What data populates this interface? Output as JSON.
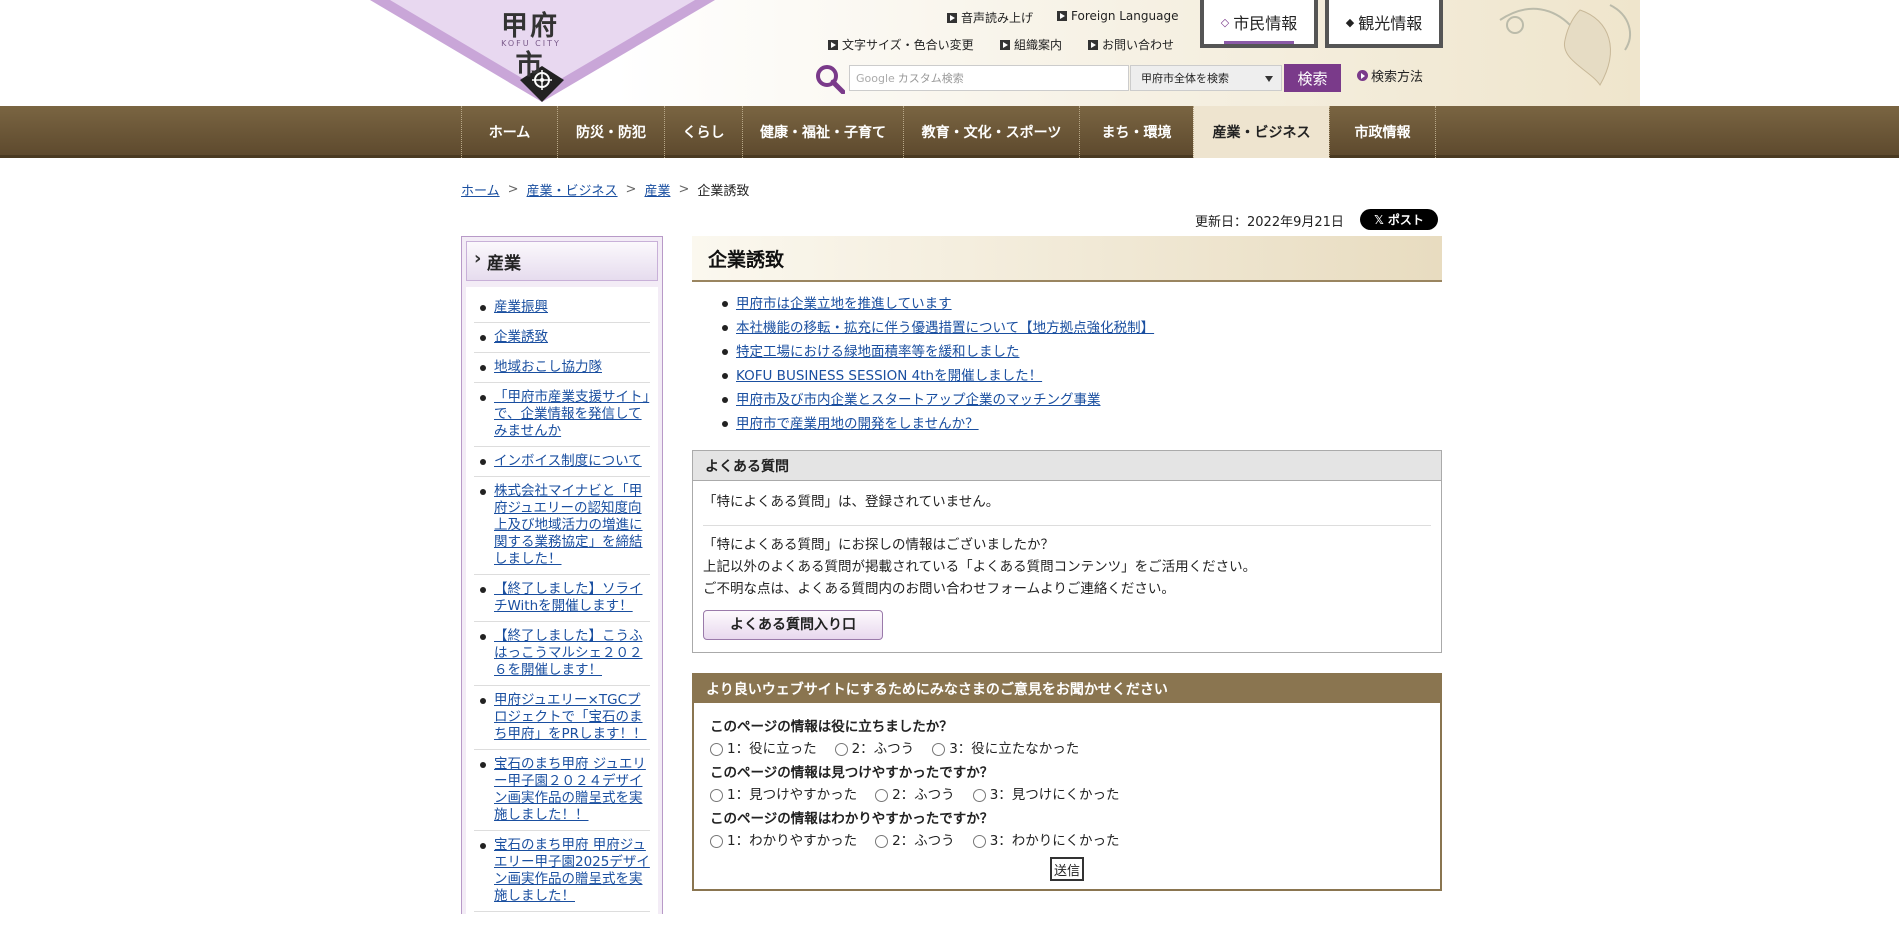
{
  "header": {
    "logo_text": "甲府市",
    "logo_sub": "KOFU CITY",
    "top_links": [
      "音声読み上げ",
      "Foreign Language",
      "文字サイズ・色合い変更",
      "組織案内",
      "お問い合わせ"
    ],
    "tab_citizen": "市民情報",
    "tab_tourism": "観光情報",
    "search_placeholder": "カスタム検索",
    "search_google": "Google",
    "search_scope": "甲府市全体を検索",
    "search_button": "検索",
    "search_help": "検索方法"
  },
  "nav": {
    "items": [
      "ホーム",
      "防災・防犯",
      "くらし",
      "健康・福祉・子育て",
      "教育・文化・スポーツ",
      "まち・環境",
      "産業・ビジネス",
      "市政情報"
    ],
    "active": "産業・ビジネス"
  },
  "breadcrumb": {
    "items": [
      "ホーム",
      "産業・ビジネス",
      "産業"
    ],
    "current": "企業誘致"
  },
  "updated": "更新日：2022年9月21日",
  "xpost_label": "ポスト",
  "side": {
    "title": "産業",
    "items": [
      "産業振興",
      "企業誘致",
      "地域おこし協力隊",
      "「甲府市産業支援サイト」で、企業情報を発信してみませんか",
      "インボイス制度について",
      "株式会社マイナビと「甲府ジュエリーの認知度向上及び地域活力の増進に関する業務協定」を締結しました！",
      "【終了しました】ソライチWithを開催します！",
      "【終了しました】こうふはっこうマルシェ２０２６を開催します！",
      "甲府ジュエリー×TGCプロジェクトで「宝石のまち甲府」をPRします！！",
      "宝石のまち甲府 ジュエリー甲子園２０２４デザイン画実作品の贈呈式を実施しました！！",
      "宝石のまち甲府 甲府ジュエリー甲子園2025デザイン画実作品の贈呈式を実施しました！"
    ]
  },
  "main": {
    "title": "企業誘致",
    "links": [
      "甲府市は企業立地を推進しています",
      "本社機能の移転・拡充に伴う優遇措置について【地方拠点強化税制】",
      "特定工場における緑地面積率等を緩和しました",
      "KOFU BUSINESS SESSION 4thを開催しました！",
      "甲府市及び市内企業とスタートアップ企業のマッチング事業",
      "甲府市で産業用地の開発をしませんか？"
    ]
  },
  "faq": {
    "heading": "よくある質問",
    "none_text": "「特によくある質問」は、登録されていません。",
    "line1": "「特によくある質問」にお探しの情報はございましたか？",
    "line2": "上記以外のよくある質問が掲載されている「よくある質問コンテンツ」をご活用ください。",
    "line3": "ご不明な点は、よくある質問内のお問い合わせフォームよりご連絡ください。",
    "button": "よくある質問入り口"
  },
  "survey": {
    "heading": "より良いウェブサイトにするためにみなさまのご意見をお聞かせください",
    "questions": [
      {
        "q": "このページの情報は役に立ちましたか？",
        "options": [
          "1：役に立った",
          "2：ふつう",
          "3：役に立たなかった"
        ]
      },
      {
        "q": "このページの情報は見つけやすかったですか？",
        "options": [
          "1：見つけやすかった",
          "2：ふつう",
          "3：見つけにくかった"
        ]
      },
      {
        "q": "このページの情報はわかりやすかったですか？",
        "options": [
          "1：わかりやすかった",
          "2：ふつう",
          "3：わかりにくかった"
        ]
      }
    ],
    "submit": "送信"
  },
  "colors": {
    "nav_brown": "#6b5535",
    "accent_purple": "#7a3a8a",
    "link_blue": "#1a4fa0"
  }
}
